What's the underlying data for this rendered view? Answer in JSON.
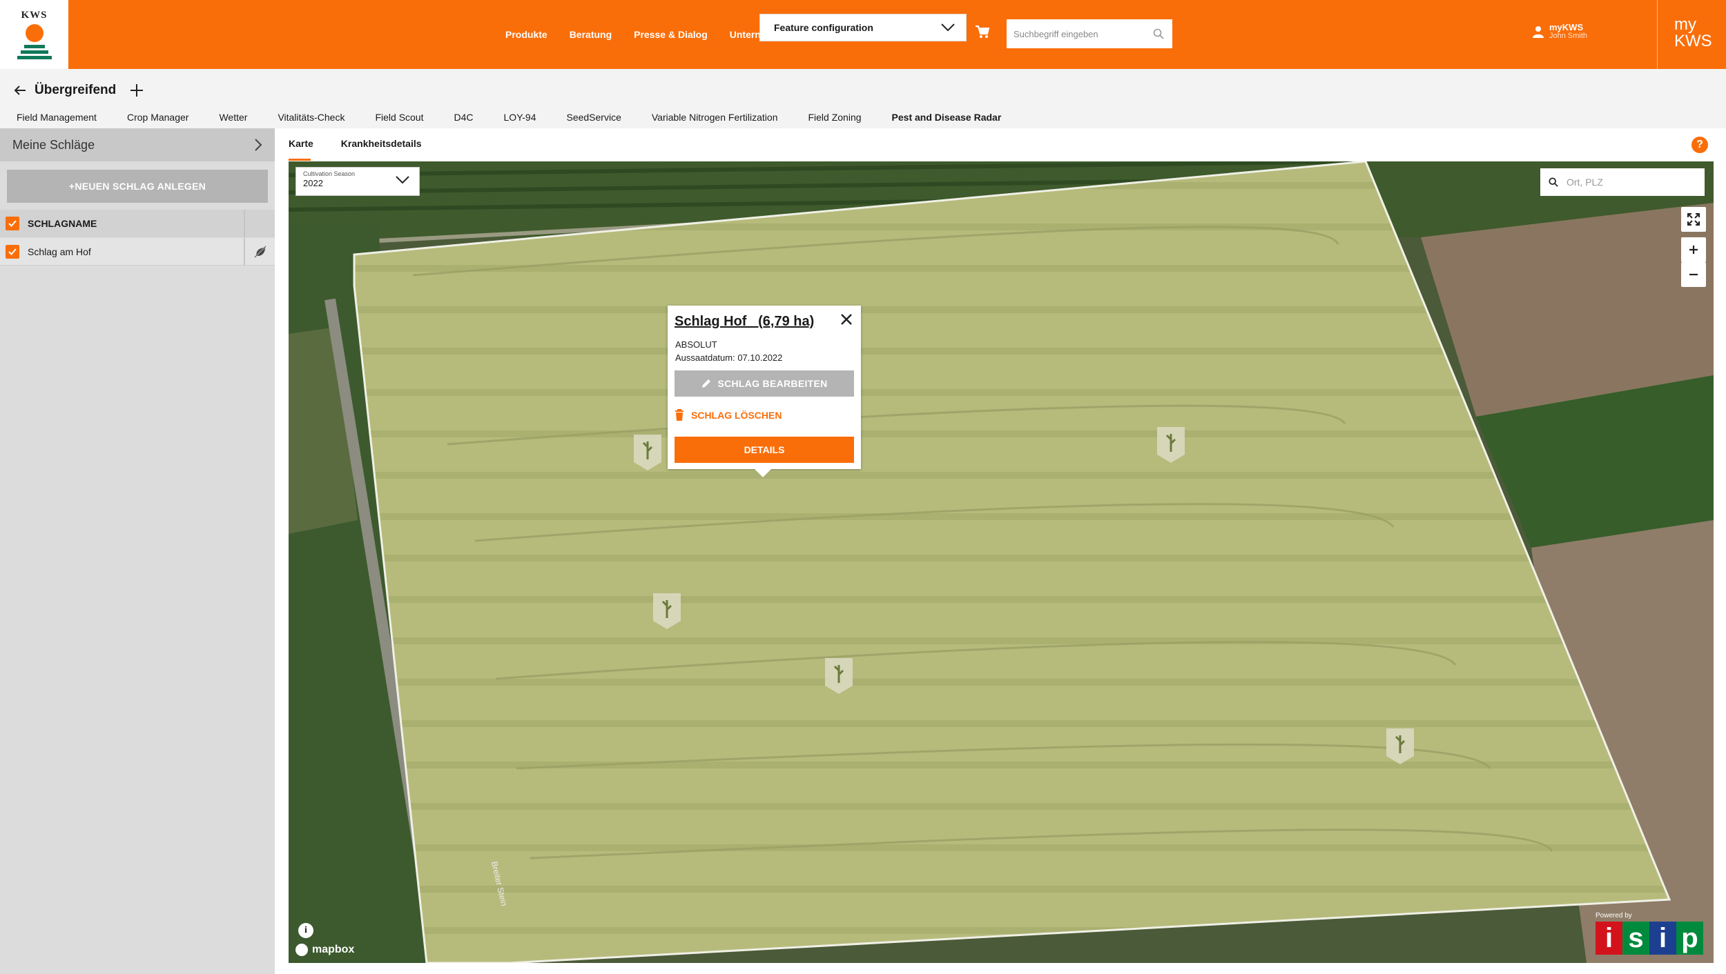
{
  "header": {
    "logo_text": "KWS",
    "nav": [
      "Produkte",
      "Beratung",
      "Presse & Dialog",
      "Untern"
    ],
    "feature_select": "Feature configuration",
    "search_placeholder": "Suchbegriff eingeben",
    "user_label": "myKWS",
    "user_name": "John Smith",
    "mykws_line1": "my",
    "mykws_line2": "KWS",
    "brand_color": "#fa6e0a"
  },
  "subheader": {
    "title": "Übergreifend",
    "tabs": [
      "Field Management",
      "Crop Manager",
      "Wetter",
      "Vitalitäts-Check",
      "Field Scout",
      "D4C",
      "LOY-94",
      "SeedService",
      "Variable Nitrogen Fertilization",
      "Field Zoning",
      "Pest and Disease Radar"
    ],
    "active_tab": "Pest and Disease Radar"
  },
  "sidebar": {
    "title": "Meine Schläge",
    "new_button": "+NEUEN SCHLAG ANLEGEN",
    "column_header": "SCHLAGNAME",
    "rows": [
      "Schlag am Hof"
    ]
  },
  "main": {
    "tabs": [
      "Karte",
      "Krankheitsdetails"
    ],
    "active_tab": "Karte"
  },
  "map": {
    "season_label": "Cultivation Season",
    "season_value": "2022",
    "search_placeholder": "Ort, PLZ",
    "road_label": "Breiter Stein",
    "attribution": "mapbox",
    "powered_by": "Powered by",
    "isip": [
      "i",
      "s",
      "i",
      "p"
    ],
    "isip_colors": [
      "#d2131c",
      "#008a3d",
      "#1d3f8f",
      "#008a3d"
    ]
  },
  "popup": {
    "title": "Schlag Hof   (6,79 ha)",
    "variety": "ABSOLUT",
    "sowing_date": "Aussaatdatum: 07.10.2022",
    "edit_button": "SCHLAG BEARBEITEN",
    "delete_button": "SCHLAG LÖSCHEN",
    "details_button": "DETAILS"
  }
}
